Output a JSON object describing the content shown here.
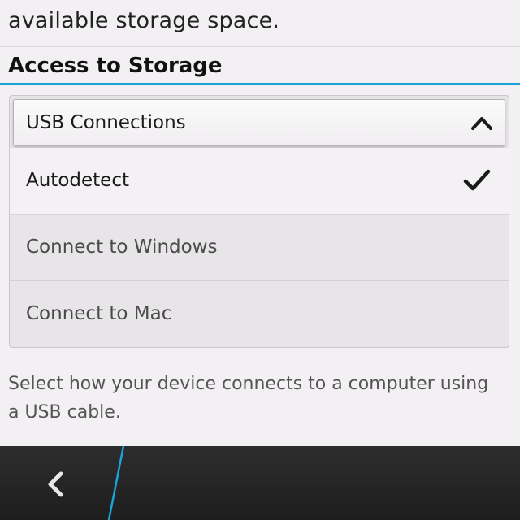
{
  "previous_section": {
    "text_tail": "available storage space."
  },
  "section": {
    "title": "Access to Storage"
  },
  "dropdown": {
    "label": "USB Connections",
    "expanded": true,
    "options": [
      {
        "label": "Autodetect",
        "selected": true
      },
      {
        "label": "Connect to Windows",
        "selected": false
      },
      {
        "label": "Connect to Mac",
        "selected": false
      }
    ]
  },
  "help": {
    "text": "Select how your device connects to a computer using a USB cable."
  },
  "nav": {
    "back_icon": "chevron-left-icon"
  },
  "colors": {
    "accent": "#1aa3d9",
    "background": "#f2f0f2",
    "nav_bar": "#262626"
  }
}
